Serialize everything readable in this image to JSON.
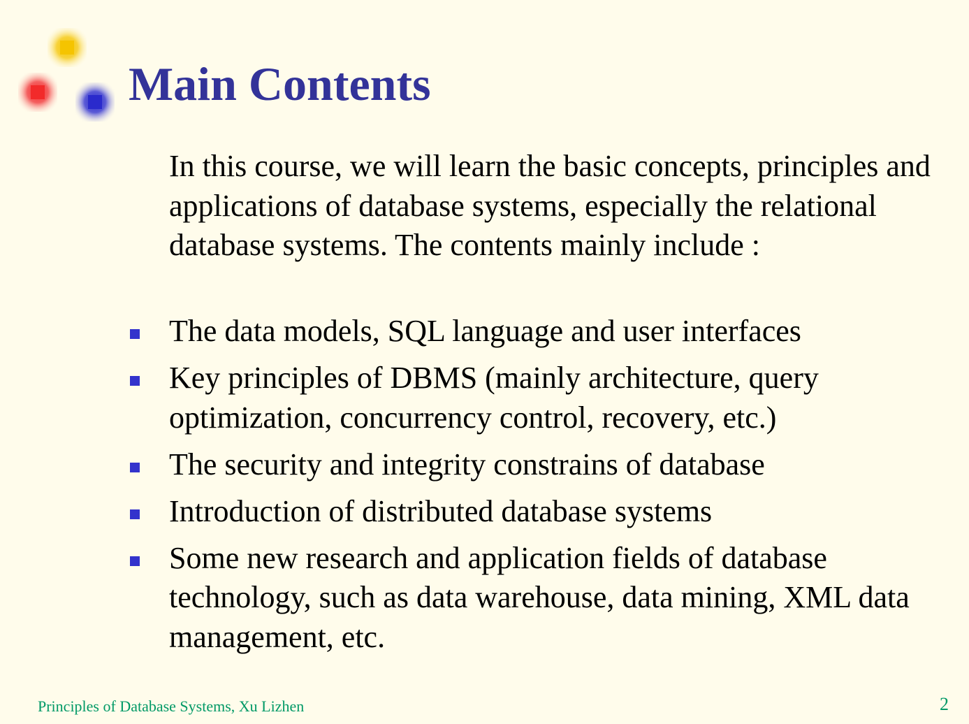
{
  "slide": {
    "title": "Main Contents",
    "intro": "In this course, we will learn the basic concepts, principles and applications of database systems, especially the relational database systems. The contents mainly include :",
    "bullets": [
      "The data models, SQL language and user interfaces",
      "Key principles of DBMS (mainly architecture, query optimization, concurrency control, recovery, etc.)",
      "The security and integrity constrains of database",
      "Introduction of distributed database systems",
      "Some new research and application fields of database technology, such as data warehouse, data mining, XML data management, etc."
    ],
    "footer": "Principles of Database Systems, Xu Lizhen",
    "page_number": "2"
  },
  "colors": {
    "background": "#FFFCEB",
    "title": "#333399",
    "bullet": "#3333CC",
    "footer": "#009966",
    "deco_yellow": "#F5C400",
    "deco_red": "#F22A2A",
    "deco_blue": "#2A2ACC"
  },
  "icons": {
    "decoration": [
      "yellow-square-icon",
      "red-square-icon",
      "blue-square-icon"
    ],
    "bullet": "square-bullet-icon"
  }
}
